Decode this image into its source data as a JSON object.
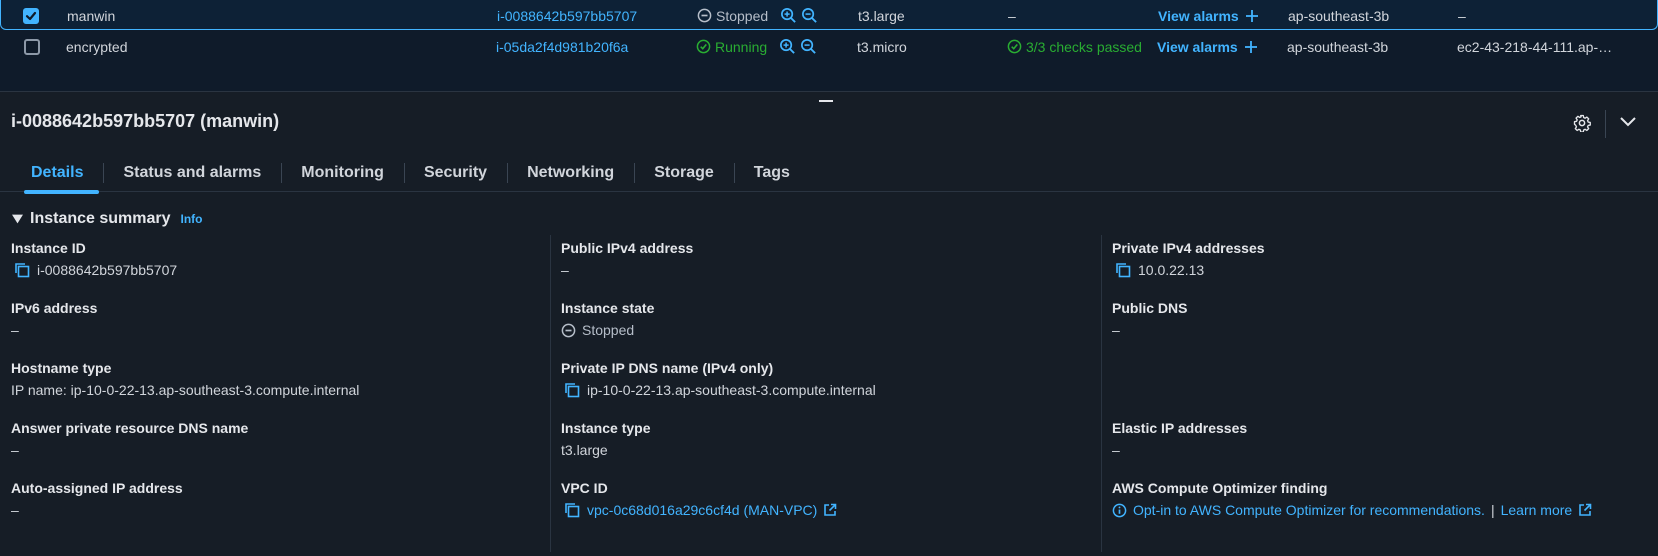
{
  "rows": [
    {
      "selected": true,
      "name": "manwin",
      "instance_id": "i-0088642b597bb5707",
      "state": "Stopped",
      "type": "t3.large",
      "checks": "–",
      "alarms": "View alarms",
      "az": "ap-southeast-3b",
      "dns": "–"
    },
    {
      "selected": false,
      "name": "encrypted",
      "instance_id": "i-05da2f4d981b20f6a",
      "state": "Running",
      "type": "t3.micro",
      "checks": "3/3 checks passed",
      "alarms": "View alarms",
      "az": "ap-southeast-3b",
      "dns": "ec2-43-218-44-111.ap-…"
    }
  ],
  "panel": {
    "title": "i-0088642b597bb5707 (manwin)",
    "tabs": [
      "Details",
      "Status and alarms",
      "Monitoring",
      "Security",
      "Networking",
      "Storage",
      "Tags"
    ],
    "active_tab": "Details"
  },
  "summary": {
    "title": "Instance summary",
    "info": "Info",
    "col0": [
      {
        "label": "Instance ID",
        "value": "i-0088642b597bb5707",
        "copy": true
      },
      {
        "label": "IPv6 address",
        "value": "–"
      },
      {
        "label": "Hostname type",
        "value": "IP name: ip-10-0-22-13.ap-southeast-3.compute.internal"
      },
      {
        "label": "Answer private resource DNS name",
        "value": "–"
      },
      {
        "label": "Auto-assigned IP address",
        "value": "–"
      }
    ],
    "col1": [
      {
        "label": "Public IPv4 address",
        "value": "–"
      },
      {
        "label": "Instance state",
        "value": "Stopped"
      },
      {
        "label": "Private IP DNS name (IPv4 only)",
        "value": "ip-10-0-22-13.ap-southeast-3.compute.internal",
        "copy": true
      },
      {
        "label": "Instance type",
        "value": "t3.large"
      },
      {
        "label": "VPC ID",
        "value": "vpc-0c68d016a29c6cf4d (MAN-VPC)",
        "copy": true,
        "link": true
      }
    ],
    "col2": [
      {
        "label": "Private IPv4 addresses",
        "value": "10.0.22.13",
        "copy": true
      },
      {
        "label": "Public DNS",
        "value": "–"
      },
      {
        "label": "Elastic IP addresses",
        "value": "–"
      },
      {
        "label": "AWS Compute Optimizer finding",
        "value": "Opt-in to AWS Compute Optimizer for recommendations.",
        "separator": "|",
        "learn_more": "Learn more"
      }
    ]
  },
  "colors": {
    "accent": "#42b4ff",
    "success": "#29ad32",
    "bg": "#0f1b2a",
    "panel": "#161d26"
  }
}
